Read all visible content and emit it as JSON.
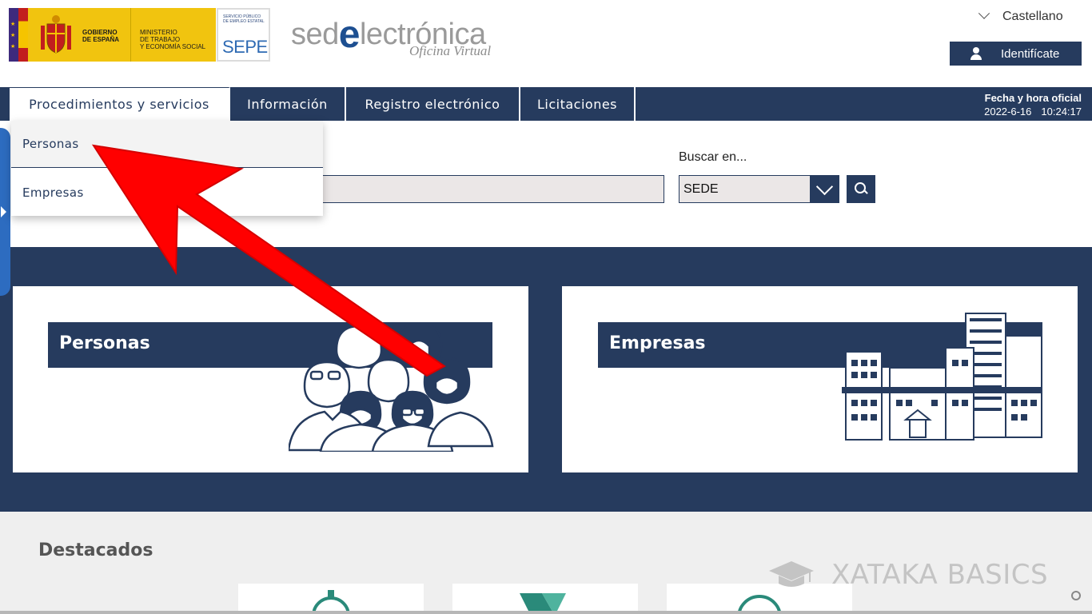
{
  "header": {
    "gov_name": "GOBIERNO\nDE ESPAÑA",
    "ministry": "MINISTERIO\nDE TRABAJO\nY ECONOMÍA SOCIAL",
    "sepe_small": "SERVICIO PÚBLICO\nDE EMPLEO ESTATAL",
    "sepe_label": "SEPE",
    "brand_prefix": "sed",
    "brand_e": "e",
    "brand_suffix": "lectrónica",
    "brand_sub": "Oficina Virtual",
    "language": "Castellano",
    "identify_label": "Identifícate"
  },
  "nav": {
    "items": [
      {
        "label": "Procedimientos y servicios"
      },
      {
        "label": "Información"
      },
      {
        "label": "Registro electrónico"
      },
      {
        "label": "Licitaciones"
      }
    ],
    "clock_title": "Fecha y hora oficial",
    "date": "2022-6-16",
    "time": "10:24:17"
  },
  "dropdown": {
    "items": [
      {
        "label": "Personas"
      },
      {
        "label": "Empresas"
      }
    ]
  },
  "search": {
    "query": "",
    "buscar_label": "Buscar en...",
    "scope_selected": "SEDE"
  },
  "cards": {
    "left": {
      "title": "Personas"
    },
    "right": {
      "title": "Empresas"
    }
  },
  "destacados": {
    "title": "Destacados"
  },
  "watermark": {
    "text": "XATAKA BASICS"
  },
  "colors": {
    "primary": "#263b5e",
    "gov_yellow": "#f1c40f",
    "annotation_arrow": "#ff0000"
  }
}
